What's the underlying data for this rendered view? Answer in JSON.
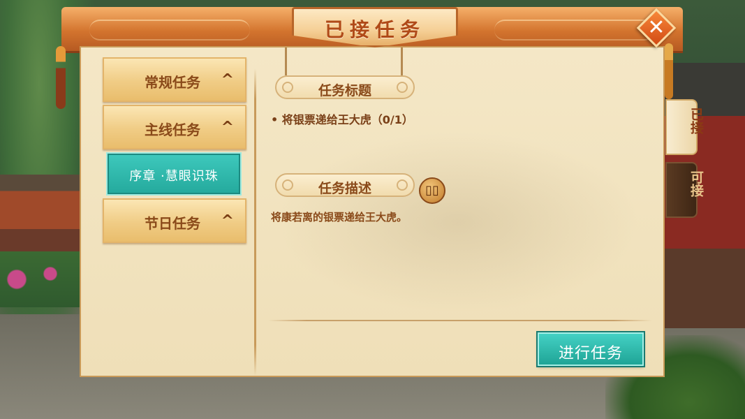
{
  "window": {
    "title": "已接任务",
    "close_symbol": "✕"
  },
  "categories": [
    {
      "label": "常规任务",
      "chevron": "^"
    },
    {
      "label": "主线任务",
      "chevron": "^"
    },
    {
      "label": "节日任务",
      "chevron": "^"
    }
  ],
  "selected_quest": {
    "label": "序章 ·慧眼识珠"
  },
  "details": {
    "title_head": "任务标题",
    "task_line": "• 将银票递给王大虎（0/1）",
    "desc_head": "任务描述",
    "desc_text": "将康若离的银票递给王大虎。",
    "book_symbol": "▯▯"
  },
  "actions": {
    "go_label": "进行任务"
  },
  "side_tabs": [
    {
      "label": "已接",
      "state": "active"
    },
    {
      "label": "可接",
      "state": "inactive"
    }
  ],
  "colors": {
    "accent_teal": "#24a99c",
    "header_orange": "#d3742e",
    "parchment": "#f4e7c6",
    "text_brown": "#8a4a1a"
  },
  "icons": [
    "close-icon",
    "chevron-up-icon",
    "book-icon"
  ]
}
